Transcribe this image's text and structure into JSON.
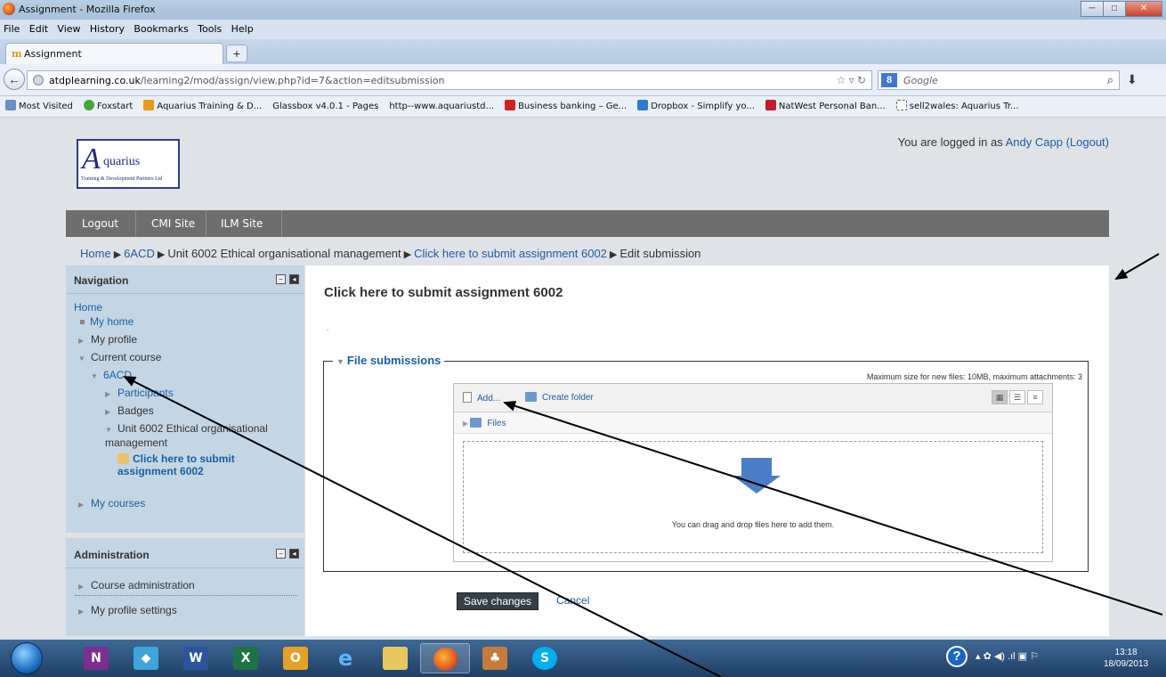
{
  "browser": {
    "window_title": "Assignment - Mozilla Firefox",
    "menu": [
      "File",
      "Edit",
      "View",
      "History",
      "Bookmarks",
      "Tools",
      "Help"
    ],
    "tab_label": "Assignment",
    "url_host": "atdplearning.co.uk",
    "url_path": "/learning2/mod/assign/view.php?id=7&action=editsubmission",
    "search_engine": "Google",
    "bookmarks": [
      "Most Visited",
      "Foxstart",
      "Aquarius Training & D...",
      "Glassbox v4.0.1 - Pages",
      "http--www.aquariustd...",
      "Business banking – Ge...",
      "Dropbox - Simplify yo...",
      "NatWest Personal Ban...",
      "sell2wales: Aquarius Tr..."
    ]
  },
  "site": {
    "logo_text": "quarius",
    "logo_letter": "A",
    "logo_sub": "Training & Development Partners Ltd",
    "login_prefix": "You are logged in as",
    "user_name": "Andy Capp",
    "logout_link": "(Logout)",
    "nav": [
      "Logout",
      "CMI Site",
      "ILM Site"
    ]
  },
  "breadcrumb": [
    "Home",
    "6ACD",
    "Unit 6002 Ethical organisational management",
    "Click here to submit assignment 6002",
    "Edit submission"
  ],
  "navigation_block": {
    "title": "Navigation",
    "home": "Home",
    "my_home": "My home",
    "my_profile": "My profile",
    "current_course": "Current course",
    "course": "6ACD",
    "participants": "Participants",
    "badges": "Badges",
    "unit": "Unit 6002 Ethical organisational management",
    "assignment": "Click here to submit assignment 6002",
    "my_courses": "My courses"
  },
  "admin_block": {
    "title": "Administration",
    "course_admin": "Course administration",
    "profile_settings": "My profile settings"
  },
  "main": {
    "heading": "Click here to submit assignment 6002",
    "dot": ".",
    "fieldset_legend": "File submissions",
    "max_size": "Maximum size for new files: 10MB, maximum attachments: 3",
    "add": "Add...",
    "create_folder": "Create folder",
    "files_path": "Files",
    "drop_msg": "You can drag and drop files here to add them.",
    "save": "Save changes",
    "cancel": "Cancel"
  },
  "taskbar": {
    "time": "13:18",
    "date": "18/09/2013"
  },
  "colors": {
    "link": "#1a5fa3",
    "sidebar": "#c4d6e3",
    "navbar": "#6e6e6e",
    "annotation_arrow": "#000000"
  }
}
